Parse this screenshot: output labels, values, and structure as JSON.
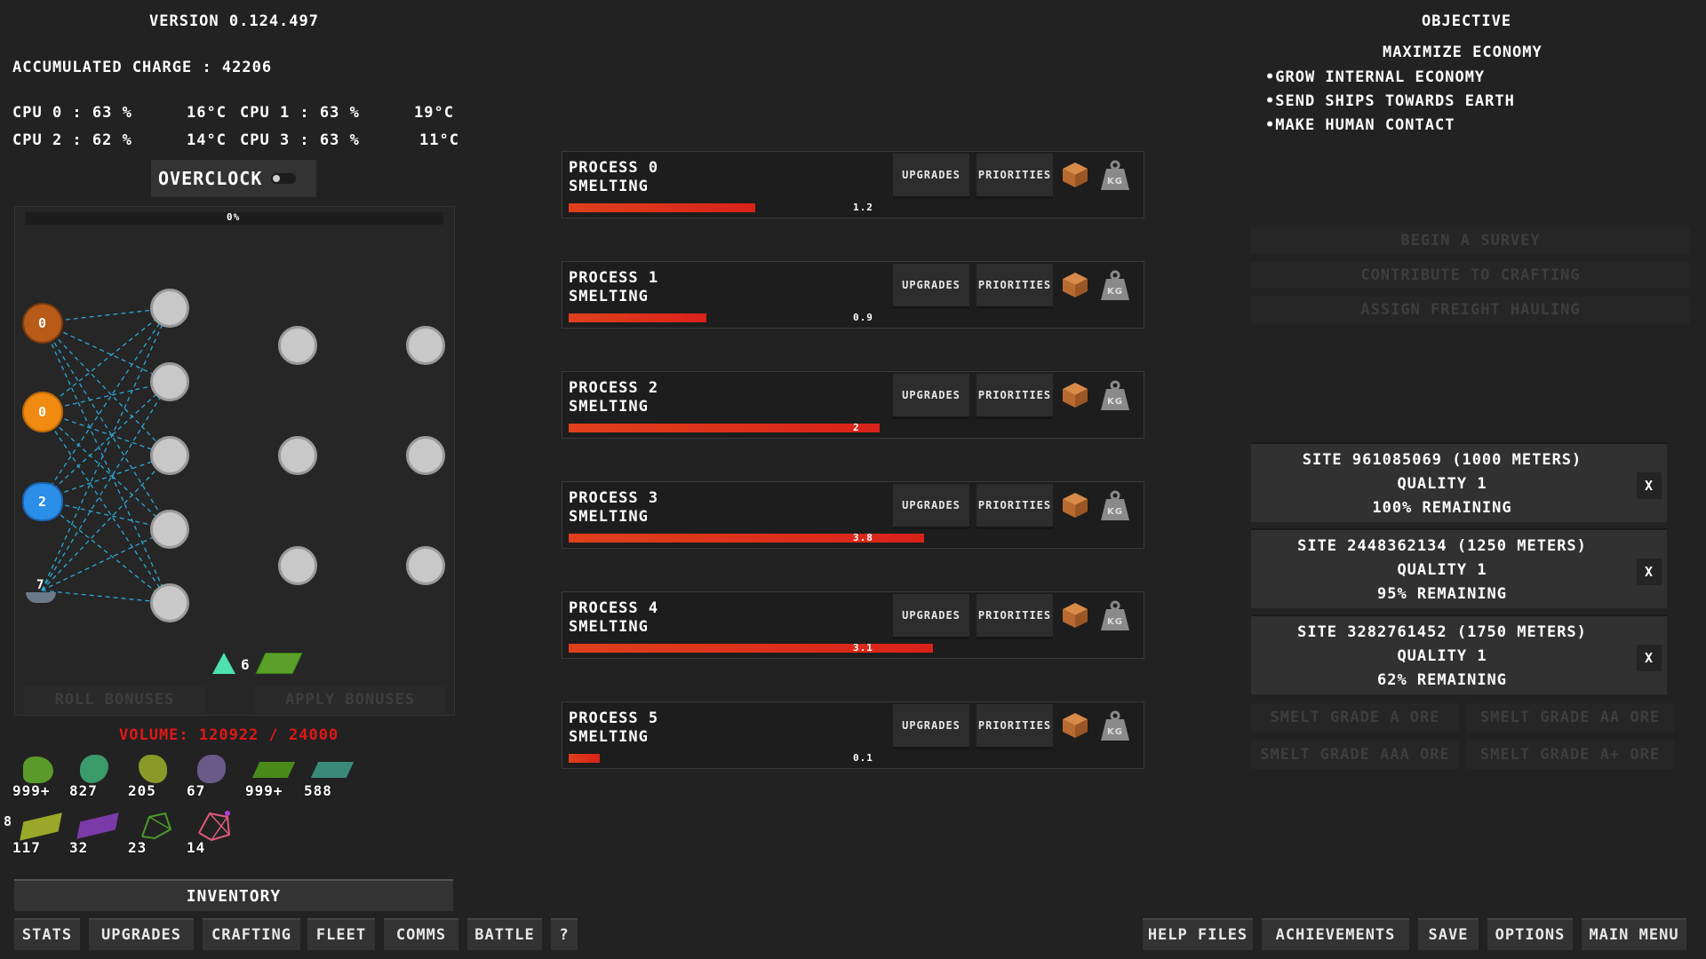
{
  "header": {
    "version": "VERSION 0.124.497",
    "charge": "ACCUMULATED CHARGE : 42206"
  },
  "cpu": [
    {
      "label": "CPU 0 : 63 %",
      "temp": "16°C"
    },
    {
      "label": "CPU 1 : 63 %",
      "temp": "19°C"
    },
    {
      "label": "CPU 2 : 62 %",
      "temp": "14°C"
    },
    {
      "label": "CPU 3 : 63 %",
      "temp": "11°C"
    }
  ],
  "overclock": {
    "label": "OVERCLOCK",
    "enabled": false
  },
  "network": {
    "progress": "0%",
    "inputs": [
      "0",
      "0",
      "2",
      "7"
    ],
    "triangle_count": "6",
    "roll_label": "ROLL BONUSES",
    "apply_label": "APPLY BONUSES"
  },
  "volume": "VOLUME: 120922 / 24000",
  "inventory": {
    "row1": [
      "999+",
      "827",
      "205",
      "67",
      "999+",
      "588"
    ],
    "row2": [
      "117",
      "32",
      "23",
      "14"
    ],
    "side_digit": "8",
    "title": "INVENTORY"
  },
  "processes": [
    {
      "title": "PROCESS 0",
      "task": "SMELTING",
      "value": "1.2",
      "fill": 0.42
    },
    {
      "title": "PROCESS 1",
      "task": "SMELTING",
      "value": "0.9",
      "fill": 0.31
    },
    {
      "title": "PROCESS 2",
      "task": "SMELTING",
      "value": "2",
      "fill": 0.7
    },
    {
      "title": "PROCESS 3",
      "task": "SMELTING",
      "value": "3.8",
      "fill": 0.8
    },
    {
      "title": "PROCESS 4",
      "task": "SMELTING",
      "value": "3.1",
      "fill": 0.82
    },
    {
      "title": "PROCESS 5",
      "task": "SMELTING",
      "value": "0.1",
      "fill": 0.07
    }
  ],
  "process_buttons": {
    "upgrades": "UPGRADES",
    "priorities": "PRIORITIES",
    "weight_icon_label": "Kg"
  },
  "objective": {
    "heading": "OBJECTIVE",
    "title": "MAXIMIZE ECONOMY",
    "items": [
      "•GROW INTERNAL ECONOMY",
      "•SEND SHIPS TOWARDS EARTH",
      "•MAKE HUMAN CONTACT"
    ]
  },
  "actions": [
    "BEGIN A SURVEY",
    "CONTRIBUTE TO CRAFTING",
    "ASSIGN FREIGHT HAULING"
  ],
  "sites": [
    {
      "name": "SITE 961085069 (1000 METERS)",
      "quality": "QUALITY 1",
      "remaining": "100% REMAINING"
    },
    {
      "name": "SITE 2448362134 (1250 METERS)",
      "quality": "QUALITY 1",
      "remaining": "95% REMAINING"
    },
    {
      "name": "SITE 3282761452 (1750 METERS)",
      "quality": "QUALITY 1",
      "remaining": "62% REMAINING"
    }
  ],
  "site_close": "X",
  "smelt": [
    "SMELT GRADE A ORE",
    "SMELT GRADE AA ORE",
    "SMELT GRADE AAA ORE",
    "SMELT GRADE A+ ORE"
  ],
  "nav_left": [
    "STATS",
    "UPGRADES",
    "CRAFTING",
    "FLEET",
    "COMMS",
    "BATTLE",
    "?"
  ],
  "nav_right": [
    "HELP FILES",
    "ACHIEVEMENTS",
    "SAVE",
    "OPTIONS",
    "MAIN MENU"
  ],
  "colors": {
    "bar": "#e0401c",
    "volume": "#e01818",
    "node_orange_dark": "#b85a18",
    "node_orange": "#f08a10",
    "node_blue": "#2b8ee8",
    "link": "#2ea7d6"
  }
}
